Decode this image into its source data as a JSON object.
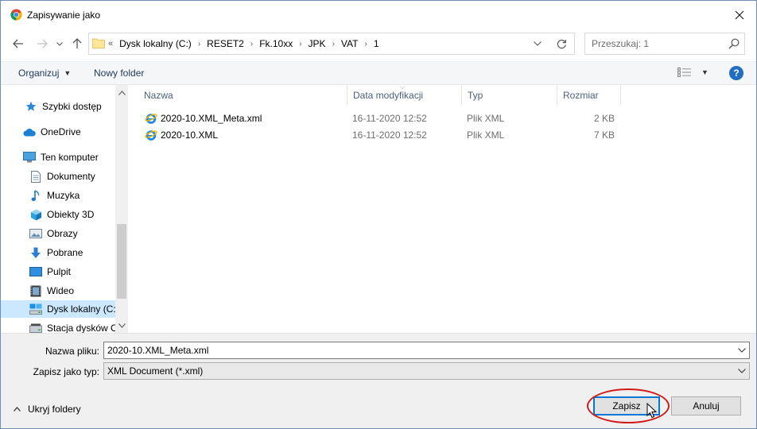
{
  "window": {
    "title": "Zapisywanie jako"
  },
  "address": {
    "overflow": "«",
    "crumbs": [
      "Dysk lokalny (C:)",
      "RESET2",
      "Fk.10xx",
      "JPK",
      "VAT",
      "1"
    ]
  },
  "search": {
    "placeholder": "Przeszukaj: 1"
  },
  "toolbar": {
    "organize_label": "Organizuj",
    "new_folder_label": "Nowy folder",
    "help_label": "?"
  },
  "nav": {
    "items": [
      {
        "label": "Szybki dostęp",
        "icon": "star-icon"
      },
      {
        "label": "OneDrive",
        "icon": "cloud-icon"
      },
      {
        "label": "Ten komputer",
        "icon": "computer-icon"
      },
      {
        "label": "Dokumenty",
        "icon": "documents-icon"
      },
      {
        "label": "Muzyka",
        "icon": "music-icon"
      },
      {
        "label": "Obiekty 3D",
        "icon": "cube-icon"
      },
      {
        "label": "Obrazy",
        "icon": "pictures-icon"
      },
      {
        "label": "Pobrane",
        "icon": "download-icon"
      },
      {
        "label": "Pulpit",
        "icon": "desktop-icon"
      },
      {
        "label": "Wideo",
        "icon": "video-icon"
      },
      {
        "label": "Dysk lokalny (C:)",
        "icon": "drive-icon",
        "selected": true
      },
      {
        "label": "Stacja dysków C",
        "icon": "disc-drive-icon"
      }
    ]
  },
  "files": {
    "columns": [
      "Nazwa",
      "Data modyfikacji",
      "Typ",
      "Rozmiar"
    ],
    "rows": [
      {
        "name": "2020-10.XML_Meta.xml",
        "date": "16-11-2020 12:52",
        "type": "Plik XML",
        "size": "2 KB"
      },
      {
        "name": "2020-10.XML",
        "date": "16-11-2020 12:52",
        "type": "Plik XML",
        "size": "7 KB"
      }
    ]
  },
  "form": {
    "filename_label": "Nazwa pliku:",
    "filename_value": "2020-10.XML_Meta.xml",
    "filetype_label": "Zapisz jako typ:",
    "filetype_value": "XML Document (*.xml)"
  },
  "footer": {
    "hide_folders_label": "Ukryj foldery",
    "save_label": "Zapisz",
    "cancel_label": "Anuluj"
  },
  "colors": {
    "accent": "#0078d7",
    "selection": "#cce8ff",
    "annotation": "#d11a1a"
  }
}
